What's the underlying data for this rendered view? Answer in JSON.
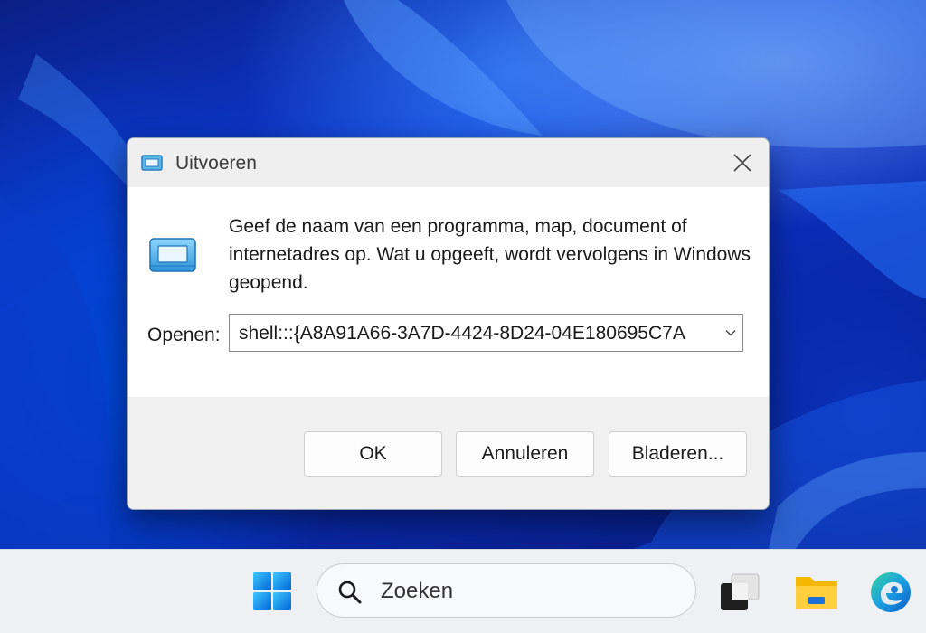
{
  "dialog": {
    "title": "Uitvoeren",
    "title_icon": "run-icon",
    "close_icon": "close-icon",
    "program_icon": "run-icon",
    "description": "Geef de naam van een programma, map, document of internetadres op. Wat u opgeeft, wordt vervolgens in Windows geopend.",
    "open_label": "Openen:",
    "open_value": "shell:::{A8A91A66-3A7D-4424-8D24-04E180695C7A",
    "dropdown_icon": "chevron-down-icon",
    "buttons": {
      "ok": "OK",
      "cancel": "Annuleren",
      "browse": "Bladeren..."
    }
  },
  "taskbar": {
    "start_icon": "windows-start-icon",
    "search_icon": "search-icon",
    "search_label": "Zoeken",
    "taskview_icon": "task-view-icon",
    "explorer_icon": "file-explorer-icon",
    "edge_icon": "edge-browser-icon"
  },
  "colors": {
    "wallpaper": "#0a2fa8",
    "dialog_bg": "#f0f0f0",
    "content_bg": "#ffffff",
    "taskbar_bg": "#eef0f3",
    "accent": "#1a73d9"
  }
}
